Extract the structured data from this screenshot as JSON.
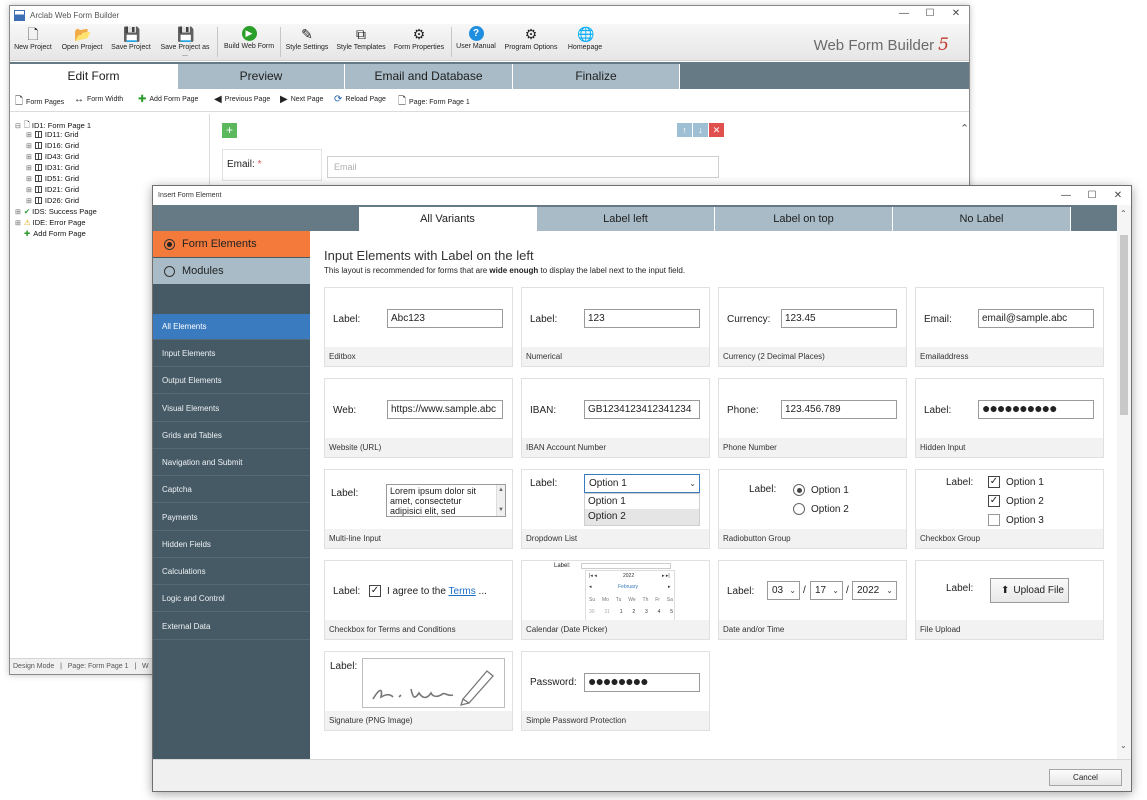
{
  "main_window": {
    "title": "Arclab Web Form Builder",
    "brand": "Web Form Builder",
    "brand_version": "5",
    "ribbon": [
      {
        "label": "New Project",
        "icon": "new-file-icon"
      },
      {
        "label": "Open Project",
        "icon": "folder-icon"
      },
      {
        "label": "Save Project",
        "icon": "save-icon"
      },
      {
        "label": "Save Project as ...",
        "icon": "save-as-icon"
      },
      {
        "label": "Build Web Form",
        "icon": "play-icon"
      },
      {
        "label": "Style Settings",
        "icon": "style-settings-icon"
      },
      {
        "label": "Style Templates",
        "icon": "style-templates-icon"
      },
      {
        "label": "Form Properties",
        "icon": "form-properties-icon"
      },
      {
        "label": "User Manual",
        "icon": "help-icon"
      },
      {
        "label": "Program Options",
        "icon": "gear-icon"
      },
      {
        "label": "Homepage",
        "icon": "globe-icon"
      }
    ],
    "tabs": [
      "Edit Form",
      "Preview",
      "Email and Database",
      "Finalize"
    ],
    "toolbar": {
      "form_pages": "Form Pages",
      "form_width": "Form Width",
      "add_form_page": "Add Form Page",
      "previous_page": "Previous Page",
      "next_page": "Next Page",
      "reload_page": "Reload Page",
      "page_indicator": "Page: Form Page 1"
    },
    "tree": [
      "ID1: Form Page 1",
      "ID11: Grid",
      "ID16: Grid",
      "ID43: Grid",
      "ID31: Grid",
      "ID51: Grid",
      "ID21: Grid",
      "ID26: Grid",
      "IDS: Success Page",
      "IDE: Error Page",
      "Add Form Page"
    ],
    "canvas": {
      "email_label": "Email:",
      "required_mark": "*",
      "email_placeholder": "Email"
    },
    "status": {
      "mode": "Design Mode",
      "sep": "|",
      "page": "Page: Form Page 1",
      "extra": "W"
    }
  },
  "dialog": {
    "title": "Insert Form Element",
    "tabs": [
      "All Variants",
      "Label left",
      "Label on top",
      "No Label"
    ],
    "mode_options": [
      "Form Elements",
      "Modules"
    ],
    "nav": [
      "All Elements",
      "Input Elements",
      "Output Elements",
      "Visual Elements",
      "Grids and Tables",
      "Navigation and Submit",
      "Captcha",
      "Payments",
      "Hidden Fields",
      "Calculations",
      "Logic and Control",
      "External Data"
    ],
    "heading": "Input Elements with Label on the left",
    "subtitle_pre": "This layout is recommended for forms that are ",
    "subtitle_bold": "wide enough",
    "subtitle_post": " to display the label next to the input field.",
    "cards": {
      "editbox": {
        "label": "Label:",
        "value": "Abc123",
        "caption": "Editbox"
      },
      "numerical": {
        "label": "Label:",
        "value": "123",
        "caption": "Numerical"
      },
      "currency": {
        "label": "Currency:",
        "value": "123.45",
        "caption": "Currency (2 Decimal Places)"
      },
      "email": {
        "label": "Email:",
        "value": "email@sample.abc",
        "caption": "Emailaddress"
      },
      "web": {
        "label": "Web:",
        "value": "https://www.sample.abc",
        "caption": "Website (URL)"
      },
      "iban": {
        "label": "IBAN:",
        "value": "GB1234123412341234",
        "caption": "IBAN Account Number"
      },
      "phone": {
        "label": "Phone:",
        "value": "123.456.789",
        "caption": "Phone Number"
      },
      "hidden": {
        "label": "Label:",
        "value": "●●●●●●●●●●",
        "caption": "Hidden Input"
      },
      "multiline": {
        "label": "Label:",
        "line1": "Lorem ipsum dolor sit",
        "line2": "amet, consectetur",
        "line3": "adipisici elit, sed",
        "caption": "Multi-line Input"
      },
      "dropdown": {
        "label": "Label:",
        "selected": "Option 1",
        "option1": "Option 1",
        "option2": "Option 2",
        "caption": "Dropdown List"
      },
      "radio": {
        "label": "Label:",
        "option1": "Option 1",
        "option2": "Option 2",
        "caption": "Radiobutton Group"
      },
      "checkbox_group": {
        "label": "Label:",
        "option1": "Option 1",
        "option2": "Option 2",
        "option3": "Option 3",
        "caption": "Checkbox Group"
      },
      "terms": {
        "label": "Label:",
        "text_pre": "I agree to the ",
        "link": "Terms",
        "text_post": " ...",
        "caption": "Checkbox for Terms and Conditions"
      },
      "calendar": {
        "label": "Label:",
        "year": "2022",
        "month": "February",
        "days_header": [
          "Su",
          "Mo",
          "Tu",
          "We",
          "Th",
          "Fr",
          "Sa"
        ],
        "week1": [
          "30",
          "31",
          "1",
          "2",
          "3",
          "4",
          "5"
        ],
        "caption": "Calendar (Date Picker)"
      },
      "date": {
        "label": "Label:",
        "month": "03",
        "day": "17",
        "year": "2022",
        "sep": "/",
        "caption": "Date and/or Time"
      },
      "upload": {
        "label": "Label:",
        "button": "Upload File",
        "caption": "File Upload"
      },
      "signature": {
        "label": "Label:",
        "caption": "Signature (PNG Image)"
      },
      "password": {
        "label": "Password:",
        "value": "●●●●●●●●",
        "caption": "Simple Password Protection"
      }
    },
    "cancel": "Cancel"
  },
  "colors": {
    "accent_orange": "#f47a3c",
    "nav_bg": "#465a66",
    "nav_active": "#3a7bbf",
    "tab_bar": "#667a86",
    "tab_inactive": "#a8bbc6"
  }
}
